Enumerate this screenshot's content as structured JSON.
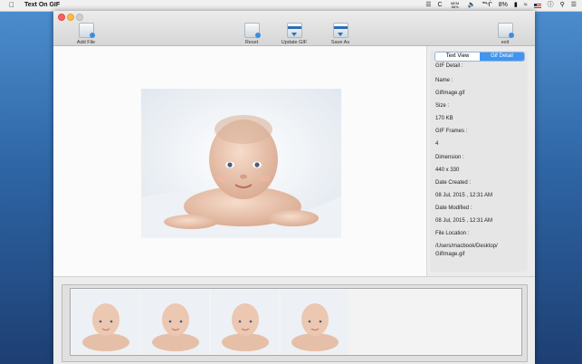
{
  "menubar": {
    "app_name": "Text On GIF",
    "mem_top": "MEM",
    "mem_value": "86%",
    "letter_c": "C",
    "battery_text": "8%",
    "icons": [
      "apple-icon",
      "list-icon",
      "bluetooth-icon",
      "volume-icon",
      "battery-icon",
      "wifi-icon",
      "flag-icon",
      "info-icon",
      "search-icon",
      "menu-icon"
    ]
  },
  "toolbar": {
    "add_file": "Add File",
    "reset": "Reset",
    "update_gif": "Update GIF",
    "save_as": "Save As",
    "exit": "exit"
  },
  "tabs": {
    "text_view": "Text View",
    "gif_detail": "Gif Detail",
    "selected": "Gif Detail"
  },
  "detail": {
    "heading": "GIF Detail :",
    "name_label": "Name :",
    "name_value": "GifImage.gif",
    "size_label": "Size :",
    "size_value": "170 KB",
    "frames_label": "GIF Frames :",
    "frames_value": "4",
    "dimension_label": "Dimension :",
    "dimension_value": "440 x 330",
    "created_label": "Date Created :",
    "created_value": "08 Jul, 2015 , 12:31 AM",
    "modified_label": "Date Modified :",
    "modified_value": "08 Jul, 2015 , 12:31 AM",
    "location_label": "File Location :",
    "location_line1": "/Users/macbook/Desktop/",
    "location_line2": "GifImage.gif"
  },
  "colors": {
    "accent": "#3f95f0",
    "close": "#fc605c",
    "minimize": "#fdbc40"
  }
}
